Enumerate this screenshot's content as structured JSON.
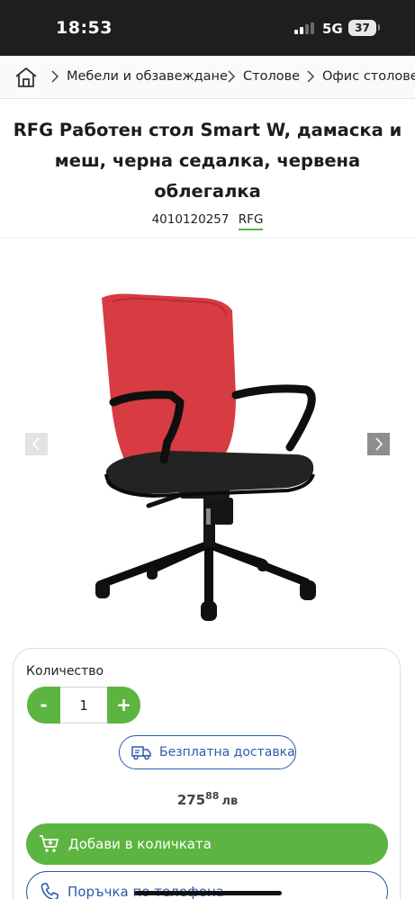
{
  "status_bar": {
    "time": "18:53",
    "network": "5G",
    "battery": "37"
  },
  "breadcrumb": {
    "home_icon": "home-icon",
    "items": [
      "Мебели и обзавеждане",
      "Столове",
      "Офис столове"
    ]
  },
  "product": {
    "title": "RFG Работен стол Smart W, дамаска и меш, черна седалка, червена облегалка",
    "sku": "4010120257",
    "brand": "RFG"
  },
  "gallery": {
    "prev_icon": "chevron-left-icon",
    "next_icon": "chevron-right-icon"
  },
  "purchase": {
    "quantity_label": "Количество",
    "quantity_minus": "-",
    "quantity_value": "1",
    "quantity_plus": "+",
    "free_shipping_label": "Безплатна доставка",
    "price_main": "275",
    "price_cents": "88",
    "currency": "лв",
    "add_to_cart_label": "Добави в количката",
    "phone_order_label": "Поръчка по телефона"
  },
  "colors": {
    "accent_green": "#5cb541",
    "accent_blue": "#2d5aa9",
    "status_bar": "#1e1e1e"
  }
}
